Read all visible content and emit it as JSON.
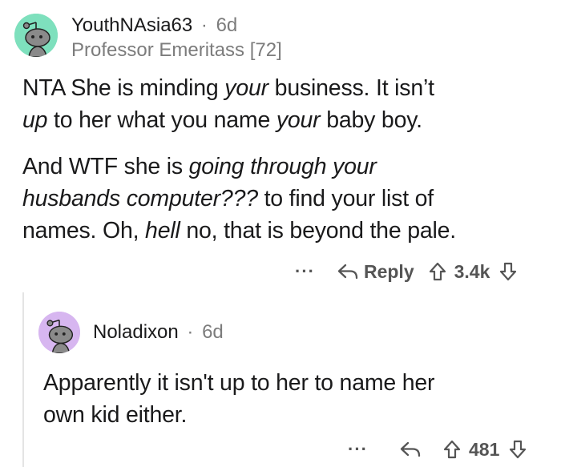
{
  "comment1": {
    "username": "YouthNAsia63",
    "separator": "·",
    "age": "6d",
    "flair": "Professor Emeritass [72]",
    "avatar_bg": "#7ee0bd",
    "line1_a": "NTA She is minding ",
    "line1_em": "your",
    "line1_b": " business. It isn’t",
    "line2_em1": "up",
    "line2_a": " to her what you name ",
    "line2_em2": "your",
    "line2_b": " baby boy.",
    "line3_a": "And WTF she is ",
    "line3_em": "going through your",
    "line4_em": "husbands computer???",
    "line4_b": " to find your list of",
    "line5_a": "names. Oh, ",
    "line5_em": "hell",
    "line5_b": " no, that is beyond the pale.",
    "more_label": "···",
    "reply_label": "Reply",
    "score": "3.4k"
  },
  "comment2": {
    "username": "Noladixon",
    "separator": "·",
    "age": "6d",
    "avatar_bg": "#d7b6f0",
    "line1": "Apparently it isn't up to her to name her",
    "line2": "own kid either.",
    "more_label": "···",
    "score": "481"
  }
}
